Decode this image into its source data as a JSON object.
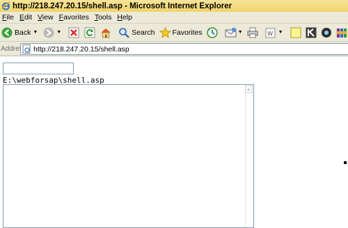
{
  "window": {
    "title": "http://218.247.20.15/shell.asp - Microsoft Internet Explorer"
  },
  "menu": {
    "items": [
      {
        "key": "F",
        "rest": "ile"
      },
      {
        "key": "E",
        "rest": "dit"
      },
      {
        "key": "V",
        "rest": "iew"
      },
      {
        "key": "F",
        "rest": "avorites"
      },
      {
        "key": "T",
        "rest": "ools"
      },
      {
        "key": "H",
        "rest": "elp"
      }
    ]
  },
  "toolbar": {
    "back_label": "Back",
    "search_label": "Search",
    "favorites_label": "Favorites"
  },
  "address": {
    "label": "Address",
    "url": "http://218.247.20.15/shell.asp"
  },
  "page": {
    "command_value": "",
    "path_text": "E:\\webforsap\\shell.asp",
    "output_text": ""
  },
  "colors": {
    "title_bar": "#f0d46a",
    "chrome": "#ece9d8",
    "field_border": "#7f9db9"
  }
}
